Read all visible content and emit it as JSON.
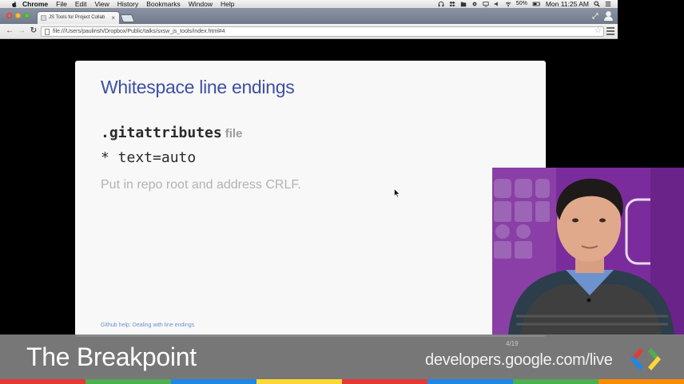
{
  "menubar": {
    "items": [
      "Chrome",
      "File",
      "Edit",
      "View",
      "History",
      "Bookmarks",
      "Window",
      "Help"
    ],
    "battery": "50%",
    "clock": "Mon 11:25 AM"
  },
  "tab": {
    "title": "JS Tools for Project Collab"
  },
  "address_bar": {
    "url": "file:///Users/paulirish/Dropbox/Public/talks/sxsw_js_tools/index.html#4"
  },
  "slide": {
    "title": "Whitespace line endings",
    "code_1": ".gitattributes",
    "code_1_suffix": "file",
    "code_2": "* text=auto",
    "body": "Put in repo root and address CRLF.",
    "footer_link": "Github help: Dealing with line endings",
    "counter": "4/19"
  },
  "overlay": {
    "show_title": "The Breakpoint",
    "url": "developers.google.com/live"
  },
  "colors": {
    "title_blue": "#3c50a5",
    "cam_purple": "#7a2c9c",
    "bar": [
      "#e53935",
      "#4caf50",
      "#1e88e5",
      "#fdd835",
      "#e53935",
      "#1e88e5",
      "#4caf50",
      "#fb8c00"
    ]
  },
  "icons": [
    "apple-icon",
    "headphones-icon",
    "wifi-icon",
    "battery-icon",
    "search-icon",
    "list-icon",
    "back-icon",
    "forward-icon",
    "reload-icon",
    "star-icon",
    "chrome-menu-icon",
    "google-developers-logo-icon"
  ]
}
